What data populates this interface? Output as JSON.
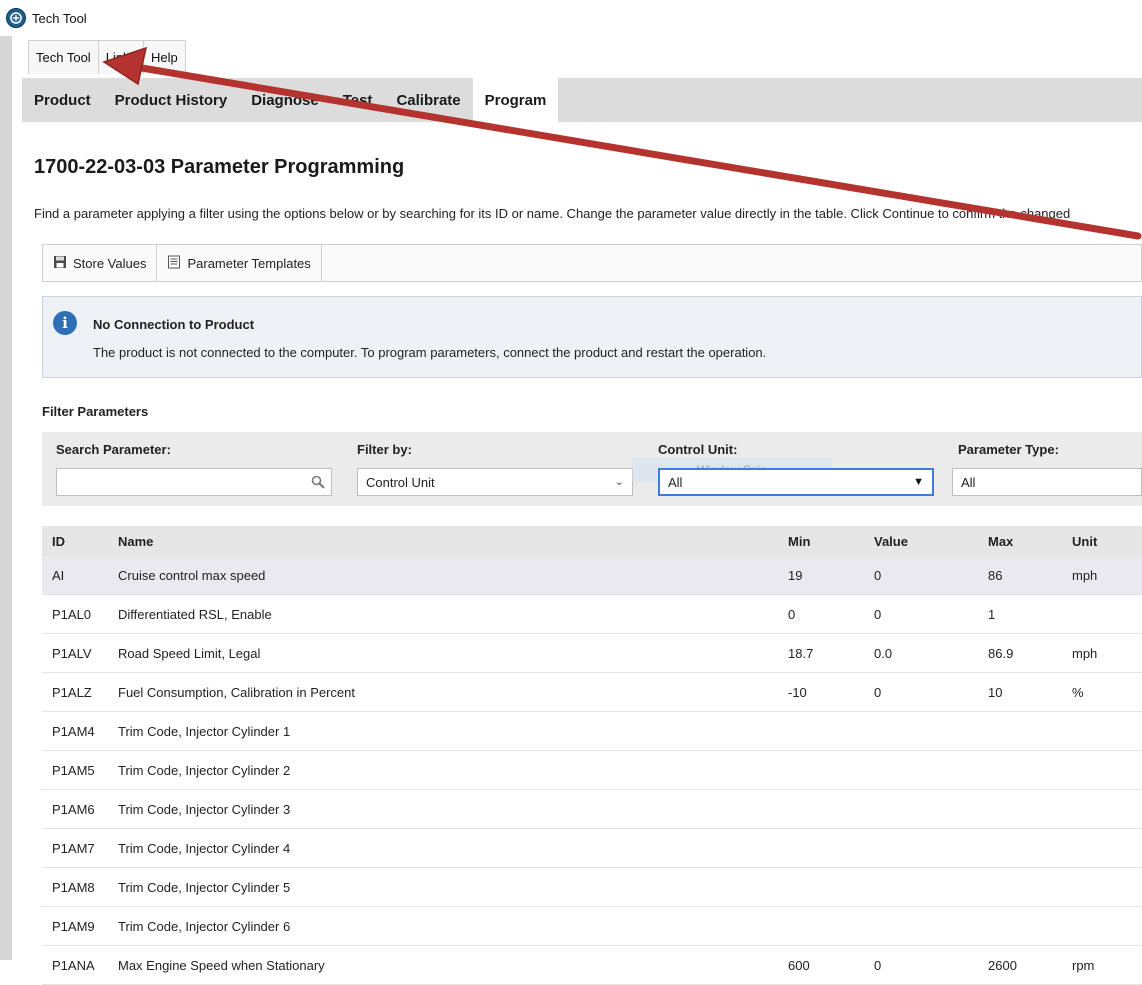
{
  "window": {
    "title": "Tech Tool"
  },
  "menu": {
    "items": [
      "Tech Tool",
      "Links",
      "Help"
    ]
  },
  "nav": {
    "tabs": [
      "Product",
      "Product History",
      "Diagnose",
      "Test",
      "Calibrate",
      "Program"
    ],
    "active": "Program"
  },
  "page": {
    "title": "1700-22-03-03 Parameter Programming",
    "instructions": "Find a parameter applying a filter using the options below or by searching for its ID or name. Change the parameter value directly in the table. Click Continue to confirm the changed"
  },
  "toolbar": {
    "store_values": "Store Values",
    "parameter_templates": "Parameter Templates"
  },
  "notice": {
    "title": "No Connection to Product",
    "body": "The product is not connected to the computer. To program parameters, connect the product and restart the operation."
  },
  "filters": {
    "heading": "Filter Parameters",
    "search_label": "Search Parameter:",
    "search_value": "",
    "filter_by_label": "Filter by:",
    "filter_by_value": "Control Unit",
    "control_unit_label": "Control Unit:",
    "control_unit_value": "All",
    "parameter_type_label": "Parameter Type:",
    "parameter_type_value": "All",
    "overlay_ghost_text": "Window Snip"
  },
  "table": {
    "headers": {
      "id": "ID",
      "name": "Name",
      "min": "Min",
      "value": "Value",
      "max": "Max",
      "unit": "Unit"
    },
    "rows": [
      {
        "id": "AI",
        "name": "Cruise control max speed",
        "min": "19",
        "value": "0",
        "max": "86",
        "unit": "mph"
      },
      {
        "id": "P1AL0",
        "name": "Differentiated RSL, Enable",
        "min": "0",
        "value": "0",
        "max": "1",
        "unit": ""
      },
      {
        "id": "P1ALV",
        "name": "Road Speed Limit, Legal",
        "min": "18.7",
        "value": "0.0",
        "max": "86.9",
        "unit": "mph"
      },
      {
        "id": "P1ALZ",
        "name": "Fuel Consumption, Calibration in Percent",
        "min": "-10",
        "value": "0",
        "max": "10",
        "unit": "%"
      },
      {
        "id": "P1AM4",
        "name": "Trim Code, Injector Cylinder 1",
        "min": "",
        "value": "",
        "max": "",
        "unit": ""
      },
      {
        "id": "P1AM5",
        "name": "Trim Code, Injector Cylinder 2",
        "min": "",
        "value": "",
        "max": "",
        "unit": ""
      },
      {
        "id": "P1AM6",
        "name": "Trim Code, Injector Cylinder 3",
        "min": "",
        "value": "",
        "max": "",
        "unit": ""
      },
      {
        "id": "P1AM7",
        "name": "Trim Code, Injector Cylinder 4",
        "min": "",
        "value": "",
        "max": "",
        "unit": ""
      },
      {
        "id": "P1AM8",
        "name": "Trim Code, Injector Cylinder 5",
        "min": "",
        "value": "",
        "max": "",
        "unit": ""
      },
      {
        "id": "P1AM9",
        "name": "Trim Code, Injector Cylinder 6",
        "min": "",
        "value": "",
        "max": "",
        "unit": ""
      },
      {
        "id": "P1ANA",
        "name": "Max Engine Speed when Stationary",
        "min": "600",
        "value": "0",
        "max": "2600",
        "unit": "rpm"
      }
    ]
  },
  "colors": {
    "annotation_arrow": "#b5332e",
    "nav_bar": "#dcdcdc",
    "info_icon": "#2e6fb5",
    "focus_border": "#3b7ddd"
  }
}
